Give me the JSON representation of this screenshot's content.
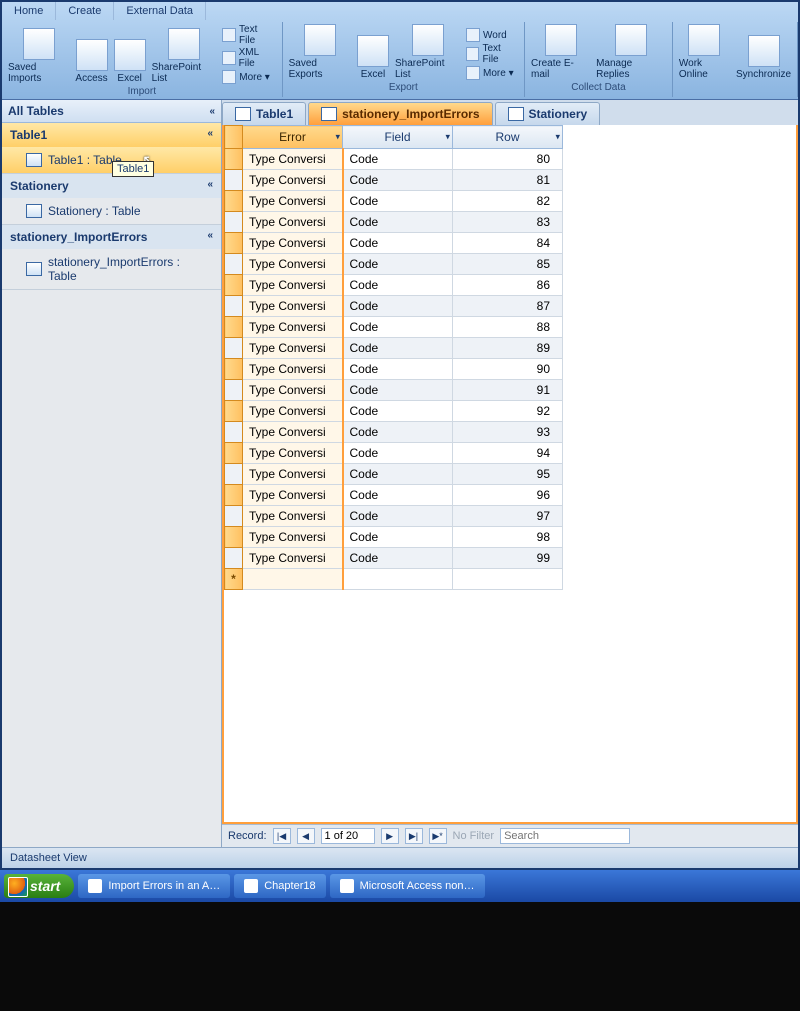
{
  "ribbon": {
    "tabs": [
      "Home",
      "Create",
      "External Data"
    ],
    "groups": {
      "import": {
        "items": {
          "saved_imports": "Saved Imports",
          "access": "Access",
          "excel": "Excel",
          "sharepoint_list": "SharePoint List",
          "text_file": "Text File",
          "xml_file": "XML File",
          "more": "More ▾"
        },
        "label": "Import"
      },
      "export": {
        "items": {
          "saved_exports": "Saved Exports",
          "excel": "Excel",
          "sharepoint_list": "SharePoint List",
          "word": "Word",
          "text_file": "Text File",
          "more": "More ▾"
        },
        "label": "Export"
      },
      "collect": {
        "items": {
          "create_email": "Create E-mail",
          "manage_replies": "Manage Replies"
        },
        "label": "Collect Data"
      },
      "lists": {
        "items": {
          "work_online": "Work Online",
          "synchronize": "Synchronize"
        }
      }
    }
  },
  "navpane": {
    "header": "All Tables",
    "collapse": "«",
    "sections": [
      {
        "title": "Table1",
        "chev": "«",
        "items": [
          {
            "label": "Table1 : Table",
            "selected": true,
            "tooltip": "Table1"
          }
        ]
      },
      {
        "title": "Stationery",
        "chev": "«",
        "items": [
          {
            "label": "Stationery : Table"
          }
        ]
      },
      {
        "title": "stationery_ImportErrors",
        "chev": "«",
        "items": [
          {
            "label": "stationery_ImportErrors : Table"
          }
        ]
      }
    ]
  },
  "doctabs": [
    {
      "label": "Table1",
      "active": false
    },
    {
      "label": "stationery_ImportErrors",
      "active": true
    },
    {
      "label": "Stationery",
      "active": false
    }
  ],
  "grid": {
    "columns": [
      "Error",
      "Field",
      "Row"
    ],
    "rows": [
      {
        "error": "Type Conversi",
        "field": "Code",
        "row": 80
      },
      {
        "error": "Type Conversi",
        "field": "Code",
        "row": 81
      },
      {
        "error": "Type Conversi",
        "field": "Code",
        "row": 82
      },
      {
        "error": "Type Conversi",
        "field": "Code",
        "row": 83
      },
      {
        "error": "Type Conversi",
        "field": "Code",
        "row": 84
      },
      {
        "error": "Type Conversi",
        "field": "Code",
        "row": 85
      },
      {
        "error": "Type Conversi",
        "field": "Code",
        "row": 86
      },
      {
        "error": "Type Conversi",
        "field": "Code",
        "row": 87
      },
      {
        "error": "Type Conversi",
        "field": "Code",
        "row": 88
      },
      {
        "error": "Type Conversi",
        "field": "Code",
        "row": 89
      },
      {
        "error": "Type Conversi",
        "field": "Code",
        "row": 90
      },
      {
        "error": "Type Conversi",
        "field": "Code",
        "row": 91
      },
      {
        "error": "Type Conversi",
        "field": "Code",
        "row": 92
      },
      {
        "error": "Type Conversi",
        "field": "Code",
        "row": 93
      },
      {
        "error": "Type Conversi",
        "field": "Code",
        "row": 94
      },
      {
        "error": "Type Conversi",
        "field": "Code",
        "row": 95
      },
      {
        "error": "Type Conversi",
        "field": "Code",
        "row": 96
      },
      {
        "error": "Type Conversi",
        "field": "Code",
        "row": 97
      },
      {
        "error": "Type Conversi",
        "field": "Code",
        "row": 98
      },
      {
        "error": "Type Conversi",
        "field": "Code",
        "row": 99
      }
    ]
  },
  "recnav": {
    "label": "Record:",
    "first": "|◀",
    "prev": "◀",
    "value": "1 of 20",
    "next": "▶",
    "last": "▶|",
    "new": "▶*",
    "nofilter": "No Filter",
    "search_placeholder": "Search"
  },
  "statusbar": "Datasheet View",
  "taskbar": {
    "start": "start",
    "buttons": [
      "Import Errors in an A…",
      "Chapter18",
      "Microsoft Access non…"
    ]
  }
}
